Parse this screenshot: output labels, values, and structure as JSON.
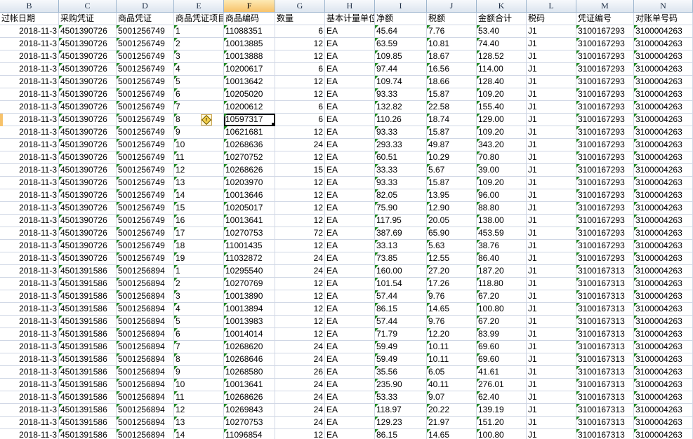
{
  "sheet": {
    "columns": [
      "B",
      "C",
      "D",
      "E",
      "F",
      "G",
      "H",
      "I",
      "J",
      "K",
      "L",
      "M",
      "N"
    ],
    "active_column": "F",
    "headers": [
      "过帐日期",
      "采购凭证",
      "商品凭证",
      "商品凭证项目",
      "商品编码",
      "数量",
      "基本计量单位",
      "净额",
      "税额",
      "金额合计",
      "税码",
      "凭证编号",
      "对账单号码"
    ],
    "rows": [
      [
        "2018-11-3",
        "4501390726",
        "5001256749",
        "1",
        "11088351",
        "6",
        "EA",
        "45.64",
        "7.76",
        "53.40",
        "J1",
        "3100167293",
        "3100004263"
      ],
      [
        "2018-11-3",
        "4501390726",
        "5001256749",
        "2",
        "10013885",
        "12",
        "EA",
        "63.59",
        "10.81",
        "74.40",
        "J1",
        "3100167293",
        "3100004263"
      ],
      [
        "2018-11-3",
        "4501390726",
        "5001256749",
        "3",
        "10013888",
        "12",
        "EA",
        "109.85",
        "18.67",
        "128.52",
        "J1",
        "3100167293",
        "3100004263"
      ],
      [
        "2018-11-3",
        "4501390726",
        "5001256749",
        "4",
        "10200617",
        "6",
        "EA",
        "97.44",
        "16.56",
        "114.00",
        "J1",
        "3100167293",
        "3100004263"
      ],
      [
        "2018-11-3",
        "4501390726",
        "5001256749",
        "5",
        "10013642",
        "12",
        "EA",
        "109.74",
        "18.66",
        "128.40",
        "J1",
        "3100167293",
        "3100004263"
      ],
      [
        "2018-11-3",
        "4501390726",
        "5001256749",
        "6",
        "10205020",
        "12",
        "EA",
        "93.33",
        "15.87",
        "109.20",
        "J1",
        "3100167293",
        "3100004263"
      ],
      [
        "2018-11-3",
        "4501390726",
        "5001256749",
        "7",
        "10200612",
        "6",
        "EA",
        "132.82",
        "22.58",
        "155.40",
        "J1",
        "3100167293",
        "3100004263"
      ],
      [
        "2018-11-3",
        "4501390726",
        "5001256749",
        "8",
        "10597317",
        "6",
        "EA",
        "110.26",
        "18.74",
        "129.00",
        "J1",
        "3100167293",
        "3100004263"
      ],
      [
        "2018-11-3",
        "4501390726",
        "5001256749",
        "9",
        "10621681",
        "12",
        "EA",
        "93.33",
        "15.87",
        "109.20",
        "J1",
        "3100167293",
        "3100004263"
      ],
      [
        "2018-11-3",
        "4501390726",
        "5001256749",
        "10",
        "10268636",
        "24",
        "EA",
        "293.33",
        "49.87",
        "343.20",
        "J1",
        "3100167293",
        "3100004263"
      ],
      [
        "2018-11-3",
        "4501390726",
        "5001256749",
        "11",
        "10270752",
        "12",
        "EA",
        "60.51",
        "10.29",
        "70.80",
        "J1",
        "3100167293",
        "3100004263"
      ],
      [
        "2018-11-3",
        "4501390726",
        "5001256749",
        "12",
        "10268626",
        "15",
        "EA",
        "33.33",
        "5.67",
        "39.00",
        "J1",
        "3100167293",
        "3100004263"
      ],
      [
        "2018-11-3",
        "4501390726",
        "5001256749",
        "13",
        "10203970",
        "12",
        "EA",
        "93.33",
        "15.87",
        "109.20",
        "J1",
        "3100167293",
        "3100004263"
      ],
      [
        "2018-11-3",
        "4501390726",
        "5001256749",
        "14",
        "10013646",
        "12",
        "EA",
        "82.05",
        "13.95",
        "96.00",
        "J1",
        "3100167293",
        "3100004263"
      ],
      [
        "2018-11-3",
        "4501390726",
        "5001256749",
        "15",
        "10205017",
        "12",
        "EA",
        "75.90",
        "12.90",
        "88.80",
        "J1",
        "3100167293",
        "3100004263"
      ],
      [
        "2018-11-3",
        "4501390726",
        "5001256749",
        "16",
        "10013641",
        "12",
        "EA",
        "117.95",
        "20.05",
        "138.00",
        "J1",
        "3100167293",
        "3100004263"
      ],
      [
        "2018-11-3",
        "4501390726",
        "5001256749",
        "17",
        "10270753",
        "72",
        "EA",
        "387.69",
        "65.90",
        "453.59",
        "J1",
        "3100167293",
        "3100004263"
      ],
      [
        "2018-11-3",
        "4501390726",
        "5001256749",
        "18",
        "11001435",
        "12",
        "EA",
        "33.13",
        "5.63",
        "38.76",
        "J1",
        "3100167293",
        "3100004263"
      ],
      [
        "2018-11-3",
        "4501390726",
        "5001256749",
        "19",
        "11032872",
        "24",
        "EA",
        "73.85",
        "12.55",
        "86.40",
        "J1",
        "3100167293",
        "3100004263"
      ],
      [
        "2018-11-3",
        "4501391586",
        "5001256894",
        "1",
        "10295540",
        "24",
        "EA",
        "160.00",
        "27.20",
        "187.20",
        "J1",
        "3100167313",
        "3100004263"
      ],
      [
        "2018-11-3",
        "4501391586",
        "5001256894",
        "2",
        "10270769",
        "12",
        "EA",
        "101.54",
        "17.26",
        "118.80",
        "J1",
        "3100167313",
        "3100004263"
      ],
      [
        "2018-11-3",
        "4501391586",
        "5001256894",
        "3",
        "10013890",
        "12",
        "EA",
        "57.44",
        "9.76",
        "67.20",
        "J1",
        "3100167313",
        "3100004263"
      ],
      [
        "2018-11-3",
        "4501391586",
        "5001256894",
        "4",
        "10013894",
        "12",
        "EA",
        "86.15",
        "14.65",
        "100.80",
        "J1",
        "3100167313",
        "3100004263"
      ],
      [
        "2018-11-3",
        "4501391586",
        "5001256894",
        "5",
        "10013983",
        "12",
        "EA",
        "57.44",
        "9.76",
        "67.20",
        "J1",
        "3100167313",
        "3100004263"
      ],
      [
        "2018-11-3",
        "4501391586",
        "5001256894",
        "6",
        "10014014",
        "12",
        "EA",
        "71.79",
        "12.20",
        "83.99",
        "J1",
        "3100167313",
        "3100004263"
      ],
      [
        "2018-11-3",
        "4501391586",
        "5001256894",
        "7",
        "10268620",
        "24",
        "EA",
        "59.49",
        "10.11",
        "69.60",
        "J1",
        "3100167313",
        "3100004263"
      ],
      [
        "2018-11-3",
        "4501391586",
        "5001256894",
        "8",
        "10268646",
        "24",
        "EA",
        "59.49",
        "10.11",
        "69.60",
        "J1",
        "3100167313",
        "3100004263"
      ],
      [
        "2018-11-3",
        "4501391586",
        "5001256894",
        "9",
        "10268580",
        "26",
        "EA",
        "35.56",
        "6.05",
        "41.61",
        "J1",
        "3100167313",
        "3100004263"
      ],
      [
        "2018-11-3",
        "4501391586",
        "5001256894",
        "10",
        "10013641",
        "24",
        "EA",
        "235.90",
        "40.11",
        "276.01",
        "J1",
        "3100167313",
        "3100004263"
      ],
      [
        "2018-11-3",
        "4501391586",
        "5001256894",
        "11",
        "10268626",
        "24",
        "EA",
        "53.33",
        "9.07",
        "62.40",
        "J1",
        "3100167313",
        "3100004263"
      ],
      [
        "2018-11-3",
        "4501391586",
        "5001256894",
        "12",
        "10269843",
        "24",
        "EA",
        "118.97",
        "20.22",
        "139.19",
        "J1",
        "3100167313",
        "3100004263"
      ],
      [
        "2018-11-3",
        "4501391586",
        "5001256894",
        "13",
        "10270753",
        "24",
        "EA",
        "129.23",
        "21.97",
        "151.20",
        "J1",
        "3100167313",
        "3100004263"
      ],
      [
        "2018-11-3",
        "4501391586",
        "5001256894",
        "14",
        "11096854",
        "12",
        "EA",
        "86.15",
        "14.65",
        "100.80",
        "J1",
        "3100167313",
        "3100004263"
      ]
    ],
    "selected_cell": {
      "row": 7,
      "column": "F"
    },
    "error_indicator_icon": "warning-diamond-icon",
    "text_number_marker_color": "#1e8a1e",
    "active_header_color": "#f7c26a"
  }
}
